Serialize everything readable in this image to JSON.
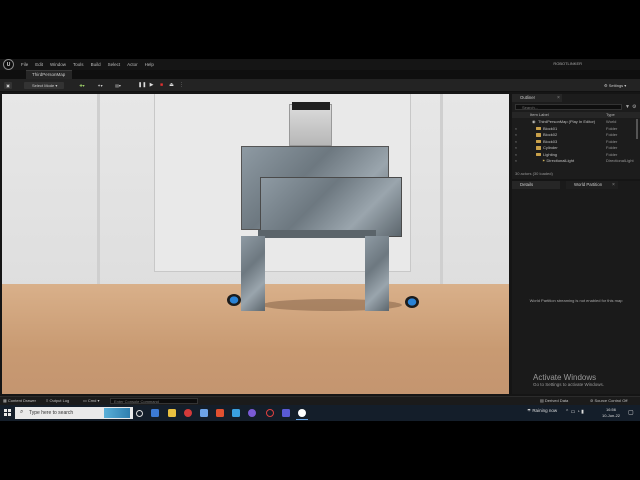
{
  "menu": {
    "logo": "U",
    "items": [
      "File",
      "Edit",
      "Window",
      "Tools",
      "Build",
      "Select",
      "Actor",
      "Help"
    ],
    "project": "ROBOTLINKER"
  },
  "tab": {
    "label": "ThirdPersonMap"
  },
  "toolbar": {
    "select_mode": "Select Mode",
    "settings": "Settings"
  },
  "outliner": {
    "tab": "Outliner",
    "search_placeholder": "Search...",
    "col_label": "Item Label",
    "col_type": "Type",
    "rows": [
      {
        "label": "ThirdPersonMap (Play In Editor)",
        "type": "World"
      },
      {
        "label": "Block01",
        "type": "Folder"
      },
      {
        "label": "Block02",
        "type": "Folder"
      },
      {
        "label": "Block03",
        "type": "Folder"
      },
      {
        "label": "Cylinder",
        "type": "Folder"
      },
      {
        "label": "Lighting",
        "type": "Folder"
      },
      {
        "label": "DirectionalLight",
        "type": "DirectionalLight"
      }
    ],
    "actors": "30 actors (30 loaded)"
  },
  "details": {
    "tab_details": "Details",
    "tab_world_partition": "World Partition",
    "message": "World Partition streaming is not enabled for this map"
  },
  "watermark": {
    "title": "Activate Windows",
    "subtitle": "Go to Settings to activate Windows."
  },
  "status": {
    "content_drawer": "Content Drawer",
    "output_log": "Output Log",
    "cmd": "Cmd",
    "console_placeholder": "Enter Console Command",
    "derived_data": "Derived Data",
    "source_control": "Source Control Off"
  },
  "taskbar": {
    "search_placeholder": "Type here to search",
    "weather": "Raining now",
    "time": "16:56",
    "date": "10-Jun-22"
  }
}
